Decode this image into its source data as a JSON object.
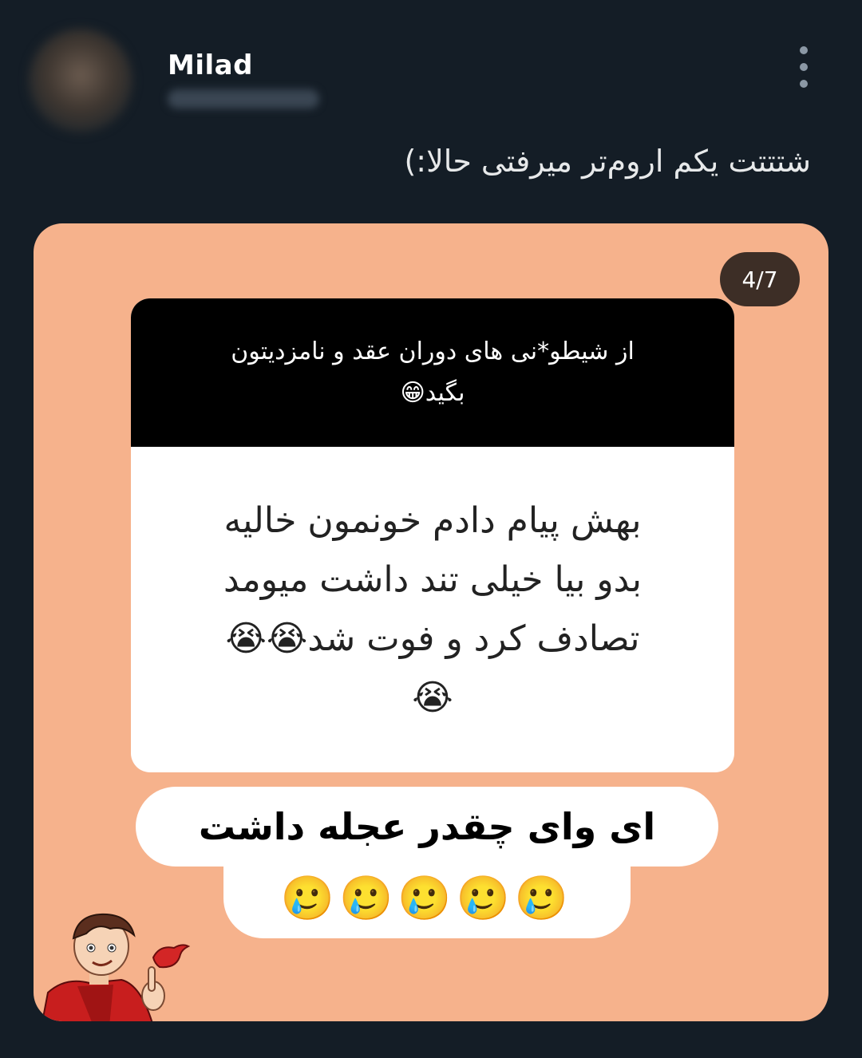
{
  "author": {
    "name": "Milad"
  },
  "tweet": {
    "text": "شتتتت یکم اروم‌تر میرفتی حالا:)"
  },
  "media": {
    "page_indicator": "4/7",
    "question": {
      "line1": "از شیطو*نی های دوران عقد و نامزدیتون",
      "line2": "بگید😁"
    },
    "answer": {
      "line1": "بهش پیام دادم خونمون خالیه",
      "line2": "بدو بیا خیلی تند داشت میومد",
      "line3": "تصادف کرد و فوت شد😭😭",
      "line4": "😭"
    },
    "reply": {
      "text": "ای وای چقدر عجله داشت",
      "emojis": "🥲🥲🥲🥲🥲"
    }
  },
  "colors": {
    "background": "#141d26",
    "media_background": "#f6b28c",
    "badge": "#3d2e26"
  },
  "icons": {
    "menu": "more-vertical-icon",
    "sticker": "cartoon-man-twitter-bird-sticker"
  }
}
